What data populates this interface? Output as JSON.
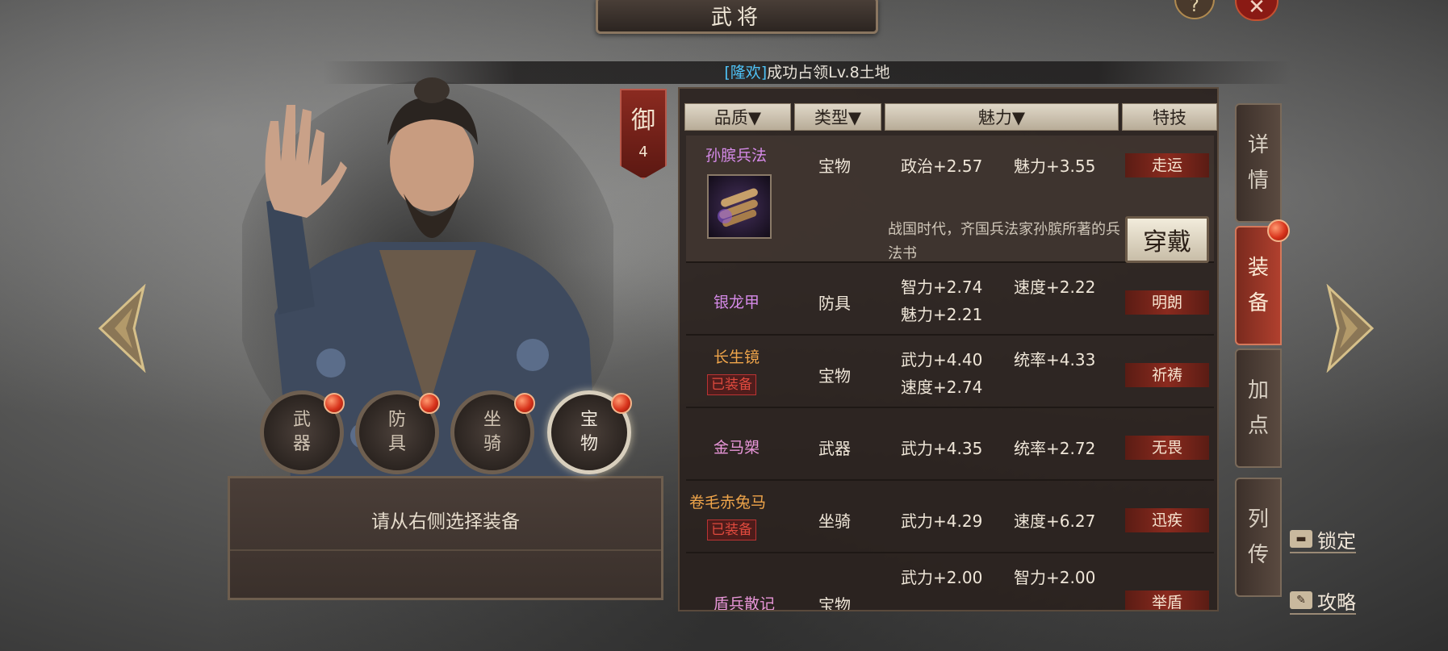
{
  "header": {
    "title": "武将",
    "help_label": "?",
    "close_label": "✕"
  },
  "notice": {
    "player": "[隆欢]",
    "message": "成功占领Lv.8土地"
  },
  "rank": {
    "label": "御",
    "value": "4"
  },
  "slots": [
    {
      "label": "武\n器"
    },
    {
      "label": "防\n具"
    },
    {
      "label": "坐\n骑"
    },
    {
      "label": "宝\n物"
    }
  ],
  "slot_panel": {
    "hint": "请从右侧选择装备"
  },
  "columns": {
    "quality": "品质▼",
    "type": "类型▼",
    "charm": "魅力▼",
    "skill": "特技"
  },
  "items": [
    {
      "name": "孙膑兵法",
      "type": "宝物",
      "stat1": "政治+2.57",
      "stat2": "魅力+3.55",
      "stat3": "",
      "skill": "走运",
      "equipped": "",
      "description": "战国时代，齐国兵法家孙膑所著的兵法书",
      "action": "穿戴"
    },
    {
      "name": "银龙甲",
      "type": "防具",
      "stat1": "智力+2.74",
      "stat2": "速度+2.22",
      "stat3": "魅力+2.21",
      "skill": "明朗",
      "equipped": ""
    },
    {
      "name": "长生镜",
      "type": "宝物",
      "stat1": "武力+4.40",
      "stat2": "统率+4.33",
      "stat3": "速度+2.74",
      "skill": "祈祷",
      "equipped": "已装备"
    },
    {
      "name": "金马槊",
      "type": "武器",
      "stat1": "武力+4.35",
      "stat2": "统率+2.72",
      "stat3": "",
      "skill": "无畏",
      "equipped": ""
    },
    {
      "name": "卷毛赤兔马",
      "type": "坐骑",
      "stat1": "武力+4.29",
      "stat2": "速度+6.27",
      "stat3": "",
      "skill": "迅疾",
      "equipped": "已装备"
    },
    {
      "name": "盾兵散记",
      "type": "宝物",
      "stat1": "武力+2.00",
      "stat2": "智力+2.00",
      "stat3": "",
      "skill": "举盾",
      "equipped": ""
    }
  ],
  "side_tabs": [
    {
      "label": "详\n情"
    },
    {
      "label": "装\n备"
    },
    {
      "label": "加\n点"
    },
    {
      "label": "列\n传"
    }
  ],
  "bottom": {
    "lock": "锁定",
    "guide": "攻略"
  },
  "colors": {
    "purple_quality": "#d58ae8",
    "orange_quality": "#f0a54a",
    "skill_bg": "#8a2a1e",
    "red_dot": "#d8341c"
  }
}
